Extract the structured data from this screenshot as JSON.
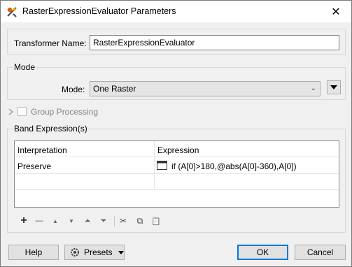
{
  "window": {
    "title": "RasterExpressionEvaluator Parameters",
    "close_glyph": "✕"
  },
  "transformer": {
    "label": "Transformer Name:",
    "value": "RasterExpressionEvaluator"
  },
  "mode_group": {
    "title": "Mode",
    "label": "Mode:",
    "value": "One Raster"
  },
  "group_processing": {
    "label": "Group Processing",
    "checked": false
  },
  "band_expressions": {
    "title": "Band Expression(s)",
    "columns": [
      "Interpretation",
      "Expression"
    ],
    "rows": [
      {
        "interpretation": "Preserve",
        "expression": "if (A[0]>180,@abs(A[0]-360),A[0])"
      }
    ]
  },
  "toolbar": {
    "add": "+",
    "remove": "—",
    "move_up": "▲",
    "move_down": "▼",
    "move_top": "⏶",
    "move_bottom": "⏷",
    "cut": "✂",
    "copy": "⧉",
    "paste": "📋"
  },
  "footer": {
    "help": "Help",
    "presets": "Presets",
    "ok": "OK",
    "cancel": "Cancel"
  }
}
